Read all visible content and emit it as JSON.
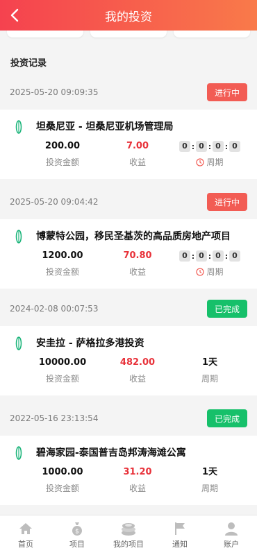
{
  "header": {
    "title": "我的投资"
  },
  "section_title": "投资记录",
  "labels": {
    "amount": "投资金额",
    "profit": "收益",
    "period": "周期"
  },
  "records": [
    {
      "time": "2025-05-20 09:09:35",
      "status": "进行中",
      "name": "坦桑尼亚 - 坦桑尼亚机场管理局",
      "amount": "200.00",
      "profit": "7.00",
      "timer": [
        "0",
        "0",
        "0",
        "0"
      ]
    },
    {
      "time": "2025-05-20 09:04:42",
      "status": "进行中",
      "name": "博蒙特公园，移民圣基茨的高品质房地产项目",
      "amount": "1200.00",
      "profit": "70.80",
      "timer": [
        "0",
        "0",
        "0",
        "0"
      ]
    },
    {
      "time": "2024-02-08 00:07:53",
      "status": "已完成",
      "name": "安圭拉 - 萨格拉多港投资",
      "amount": "10000.00",
      "profit": "482.00",
      "period": "1天"
    },
    {
      "time": "2022-05-16 23:13:54",
      "status": "已完成",
      "name": "碧海家园-泰国普吉岛邦涛海滩公寓",
      "amount": "1000.00",
      "profit": "31.20",
      "period": "1天"
    }
  ],
  "tabbar": [
    {
      "label": "首页",
      "icon": "home-icon"
    },
    {
      "label": "项目",
      "icon": "money-bag-icon"
    },
    {
      "label": "我的项目",
      "icon": "coins-icon"
    },
    {
      "label": "通知",
      "icon": "flag-icon"
    },
    {
      "label": "账户",
      "icon": "user-icon"
    }
  ],
  "colors": {
    "accent": "#f5424f",
    "ongoing": "#f25c54",
    "done": "#16c06a",
    "profit": "#e8323a"
  }
}
